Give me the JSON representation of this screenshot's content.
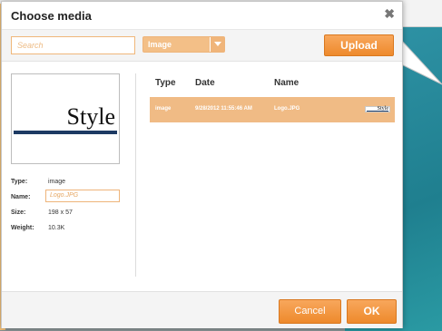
{
  "dialog": {
    "title": "Choose media",
    "close_glyph": "✖"
  },
  "toolbar": {
    "search_placeholder": "Search",
    "type_select_value": "Image",
    "upload_label": "Upload"
  },
  "preview": {
    "thumbnail_text": "Style",
    "properties": {
      "type_label": "Type:",
      "type_value": "image",
      "name_label": "Name:",
      "name_value": "Logo.JPG",
      "size_label": "Size:",
      "size_value": "198 x 57",
      "weight_label": "Weight:",
      "weight_value": "10.3K"
    }
  },
  "media_table": {
    "columns": [
      "Type",
      "Date",
      "Name"
    ],
    "rows": [
      {
        "type": "image",
        "date": "9/28/2012 11:55:46 AM",
        "name": "Logo.JPG",
        "thumb_text": "Style"
      }
    ]
  },
  "footer": {
    "cancel_label": "Cancel",
    "ok_label": "OK"
  },
  "colors": {
    "accent": "#ee8a2c",
    "selected_row": "#f0bb85",
    "logo_bar": "#1d3a63"
  }
}
